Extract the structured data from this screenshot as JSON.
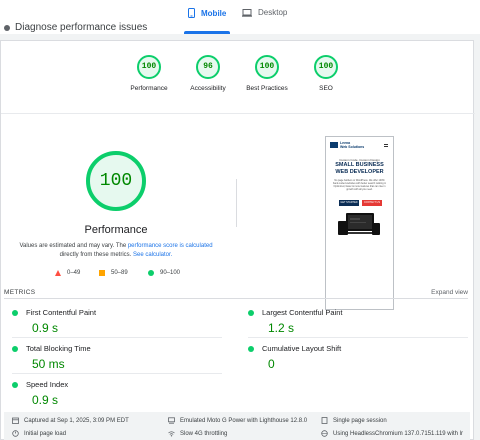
{
  "header": {
    "diagnose_text": "Diagnose performance issues",
    "tabs": [
      {
        "label": "Mobile",
        "icon": "mobile-icon",
        "active": true
      },
      {
        "label": "Desktop",
        "icon": "desktop-icon",
        "active": false
      }
    ]
  },
  "categories": [
    {
      "score": "100",
      "label": "Performance"
    },
    {
      "score": "96",
      "label": "Accessibility"
    },
    {
      "score": "100",
      "label": "Best Practices"
    },
    {
      "score": "100",
      "label": "SEO"
    }
  ],
  "performance": {
    "score": "100",
    "label": "Performance",
    "note_prefix": "Values are estimated and may vary. The ",
    "note_link1": "performance score is calculated",
    "note_mid": " directly from these metrics. ",
    "note_link2": "See calculator."
  },
  "legend": [
    {
      "range": "0–49",
      "shape": "triangle",
      "color": "#ff4e42"
    },
    {
      "range": "50–89",
      "shape": "square",
      "color": "#ffa400"
    },
    {
      "range": "90–100",
      "shape": "circle",
      "color": "#0cce6b"
    }
  ],
  "screenshot": {
    "logo_line1": "Leena",
    "logo_line2": "Web Solutions",
    "kicker": "Custom Code, Custom Design",
    "heading": "SMALL BUSINESS WEB DEVELOPER",
    "body": "No page builders or WordPress. We offer 100% hand-coded websites with better search ranking in Optimized, faster & more features that can rise in growth with all you need.",
    "btn1": "GET STARTED",
    "btn2": "CONTACT US"
  },
  "metrics": {
    "header": "METRICS",
    "expand": "Expand view",
    "items": [
      {
        "name": "First Contentful Paint",
        "value": "0.9 s"
      },
      {
        "name": "Largest Contentful Paint",
        "value": "1.2 s"
      },
      {
        "name": "Total Blocking Time",
        "value": "50 ms"
      },
      {
        "name": "Cumulative Layout Shift",
        "value": "0"
      },
      {
        "name": "Speed Index",
        "value": "0.9 s"
      }
    ]
  },
  "footer": {
    "captured": "Captured at Sep 1, 2025, 3:09 PM EDT",
    "initial": "Initial page load",
    "device": "Emulated Moto G Power with Lighthouse 12.8.0",
    "throttle": "Slow 4G throttling",
    "session": "Single page session",
    "browser": "Using HeadlessChromium 137.0.7151.119 with lr"
  },
  "colors": {
    "pass": "#0cce6b",
    "pass_text": "#008800",
    "accent": "#1a73e8"
  }
}
